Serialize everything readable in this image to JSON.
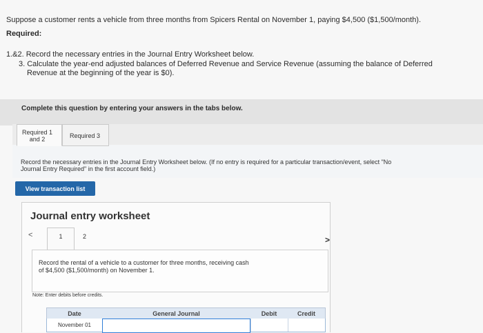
{
  "question": {
    "intro": "Suppose a customer rents a vehicle from three months from Spicers Rental on November 1, paying $4,500 ($1,500/month).",
    "required_label": "Required:",
    "req1": "1.&2. Record the necessary entries in the Journal Entry Worksheet below.",
    "req3_line1": "3. Calculate the year-end adjusted balances of Deferred Revenue and Service Revenue (assuming the balance of Deferred",
    "req3_line2": "Revenue at the beginning of the year is $0)."
  },
  "instruction_band": "Complete this question by entering your answers in the tabs below.",
  "tabs": {
    "tab1_line1": "Required 1",
    "tab1_line2": "and 2",
    "tab2": "Required 3"
  },
  "tab_instruction": {
    "line1": "Record the necessary entries in the Journal Entry Worksheet below. (If no entry is required for a particular transaction/event, select \"No",
    "line2": "Journal Entry Required\" in the first account field.)"
  },
  "view_transaction_list": "View transaction list",
  "worksheet": {
    "title": "Journal entry worksheet",
    "pager_prev": "<",
    "page1": "1",
    "page2": "2",
    "pager_next": ">",
    "description_line1": "Record the rental of a vehicle to a customer for three months, receiving cash",
    "description_line2": "of $4,500 ($1,500/month) on November 1.",
    "note": "Note: Enter debits before credits."
  },
  "journal_table": {
    "headers": {
      "date": "Date",
      "account": "General Journal",
      "debit": "Debit",
      "credit": "Credit"
    },
    "rows": [
      {
        "date": "November 01",
        "account": "",
        "debit": "",
        "credit": ""
      }
    ]
  },
  "colors": {
    "button_blue": "#2467a8",
    "header_blue": "#dfe8f3",
    "border_blue": "#9bb8d8"
  }
}
